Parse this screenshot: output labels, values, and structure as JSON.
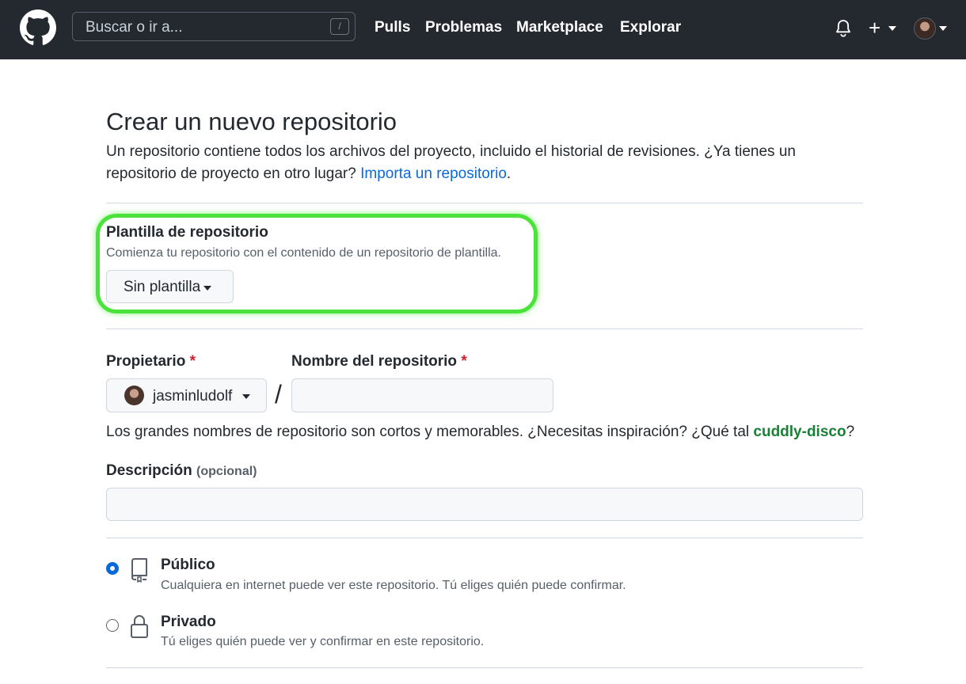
{
  "header": {
    "search_placeholder": "Buscar o ir a...",
    "search_shortcut": "/",
    "nav": [
      "Pulls",
      "Problemas",
      "Marketplace",
      "Explorar"
    ],
    "new_label": "+"
  },
  "page": {
    "title": "Crear un nuevo repositorio",
    "intro_text": "Un repositorio contiene todos los archivos del proyecto, incluido el historial de revisiones. ¿Ya tienes un repositorio de proyecto en otro lugar? ",
    "import_link": "Importa un repositorio",
    "intro_end": "."
  },
  "template": {
    "label": "Plantilla de repositorio",
    "description": "Comienza tu repositorio con el contenido de un repositorio de plantilla.",
    "selected": "Sin plantilla"
  },
  "owner": {
    "label": "Propietario",
    "required_mark": "*",
    "value": "jasminludolf"
  },
  "separator": "/",
  "repo_name": {
    "label": "Nombre del repositorio",
    "required_mark": "*",
    "value": ""
  },
  "helper": {
    "text": "Los grandes nombres de repositorio son cortos y memorables. ¿Necesitas inspiración? ¿Qué tal ",
    "suggestion": "cuddly-disco",
    "end": "?"
  },
  "description": {
    "label": "Descripción",
    "optional": "(opcional)",
    "value": ""
  },
  "visibility": [
    {
      "title": "Público",
      "description": "Cualquiera en internet puede ver este repositorio. Tú eliges quién puede confirmar.",
      "selected": true,
      "icon": "repo-icon"
    },
    {
      "title": "Privado",
      "description": "Tú eliges quién puede ver y confirmar en este repositorio.",
      "selected": false,
      "icon": "lock-icon"
    }
  ],
  "colors": {
    "header_bg": "#24292f",
    "link": "#0969da",
    "suggestion": "#1a7f37",
    "required": "#cf222e",
    "highlight": "#4be33b"
  }
}
